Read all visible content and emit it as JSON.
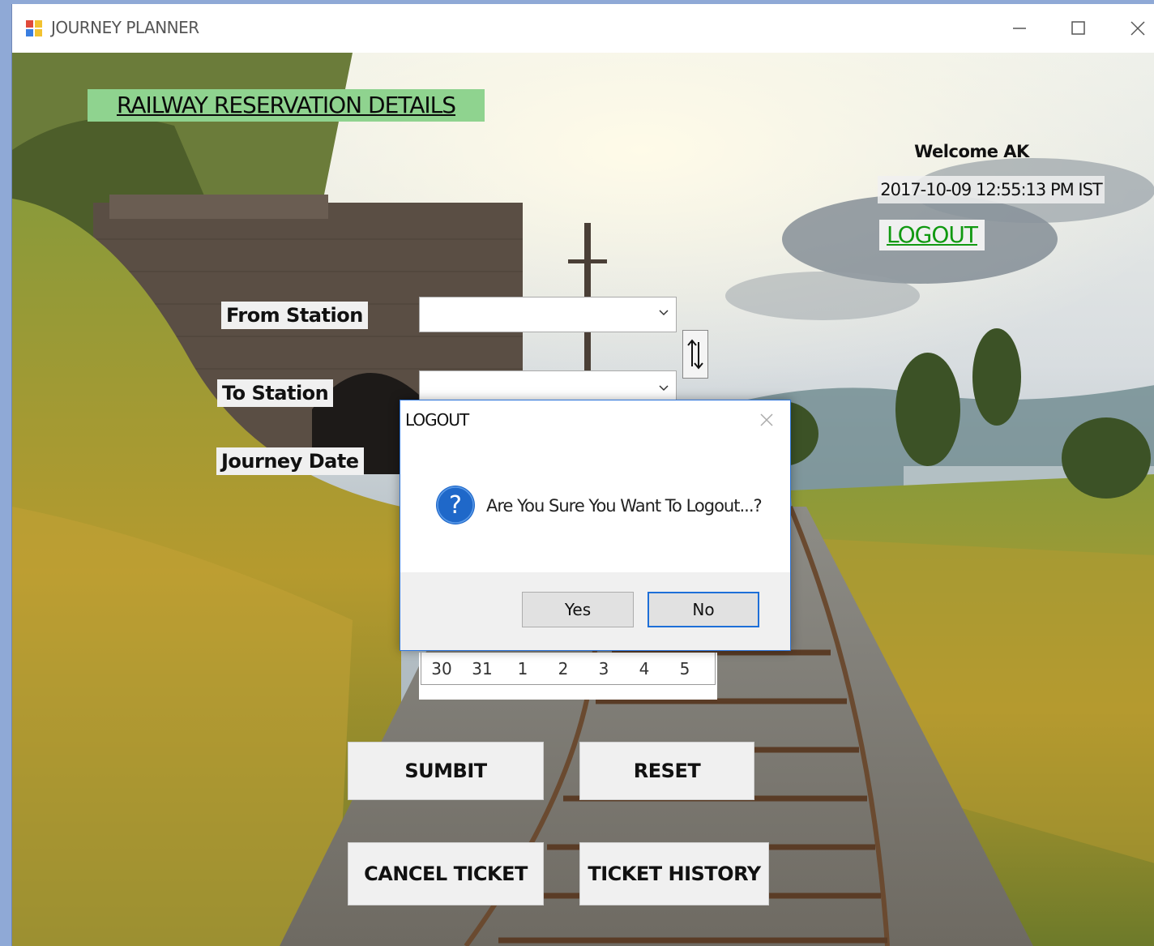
{
  "window": {
    "title": "JOURNEY PLANNER"
  },
  "header": {
    "heading": "RAILWAY RESERVATION DETAILS",
    "welcome": "Welcome AK",
    "datetime": "2017-10-09 12:55:13 PM IST",
    "logout_label": "LOGOUT"
  },
  "form": {
    "from_station_label": "From Station",
    "to_station_label": "To Station",
    "journey_date_label": "Journey Date",
    "from_station_value": "",
    "to_station_value": ""
  },
  "calendar": {
    "visible_days": [
      "30",
      "31",
      "1",
      "2",
      "3",
      "4",
      "5"
    ]
  },
  "buttons": {
    "submit": "SUMBIT",
    "reset": "RESET",
    "cancel_ticket": "CANCEL TICKET",
    "ticket_history": "TICKET HISTORY"
  },
  "dialog": {
    "title": "LOGOUT",
    "message": "Are You Sure You Want To Logout...?",
    "yes_label": "Yes",
    "no_label": "No",
    "icon": "question-icon",
    "focused_button": "No"
  },
  "colors": {
    "heading_bg": "#8fd38f",
    "logout_link": "#119911",
    "dialog_accent": "#1e6fd8"
  }
}
